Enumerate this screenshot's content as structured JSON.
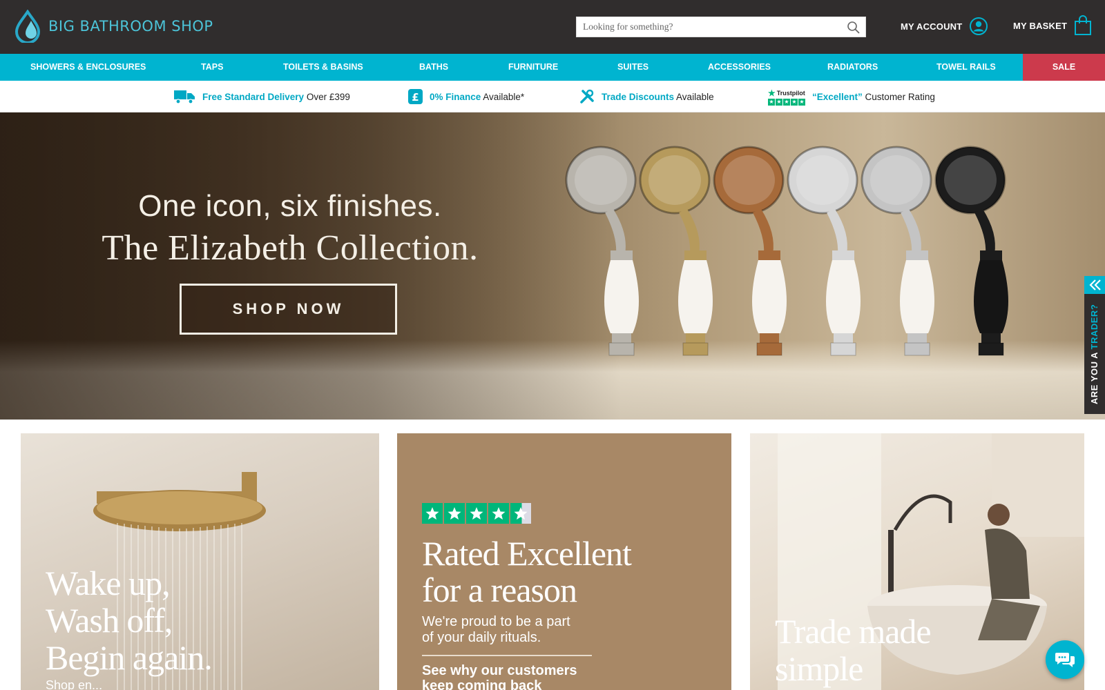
{
  "header": {
    "logo_text": "BIG BATHROOM SHOP",
    "search_placeholder": "Looking for something?",
    "account_label": "MY ACCOUNT",
    "basket_label": "MY BASKET"
  },
  "nav": {
    "items": [
      "SHOWERS & ENCLOSURES",
      "TAPS",
      "TOILETS & BASINS",
      "BATHS",
      "FURNITURE",
      "SUITES",
      "ACCESSORIES",
      "RADIATORS",
      "TOWEL RAILS"
    ],
    "sale": "SALE"
  },
  "usp": [
    {
      "highlight": "Free Standard Delivery",
      "text": "Over £399",
      "icon": "truck-icon"
    },
    {
      "highlight": "0% Finance",
      "text": "Available*",
      "icon": "pound-icon"
    },
    {
      "highlight": "Trade Discounts",
      "text": "Available",
      "icon": "tools-icon"
    },
    {
      "highlight": "“Excellent”",
      "text": "Customer Rating",
      "icon": "trustpilot-logo",
      "badge": "Trustpilot"
    }
  ],
  "hero": {
    "line1": "One icon, six finishes.",
    "line2": "The Elizabeth Collection.",
    "button": "SHOP NOW",
    "handset_finishes": [
      "#b8b4ac",
      "#b69a5c",
      "#a66a3a",
      "#d6d6d6",
      "#c4c4c4",
      "#1c1c1c"
    ]
  },
  "trader_tab": {
    "prefix": "ARE YOU A ",
    "highlight": "TRADER?"
  },
  "panels": {
    "shower": {
      "title_lines": [
        "Wake up,",
        "Wash off,",
        "Begin again."
      ],
      "sub": "Shop en..."
    },
    "reviews": {
      "title_lines": [
        "Rated Excellent",
        "for a reason"
      ],
      "body_lines": [
        "We're proud to be a part",
        "of your daily rituals."
      ],
      "cta_lines": [
        "See why our customers",
        "keep coming back"
      ],
      "rating": 4.5
    },
    "trade": {
      "title_lines": [
        "Trade made",
        "simple"
      ]
    }
  },
  "colors": {
    "header_bg": "#302d2d",
    "nav_bg": "#00b4d0",
    "sale_bg": "#cc3a4c",
    "trustpilot_green": "#00b67a"
  }
}
